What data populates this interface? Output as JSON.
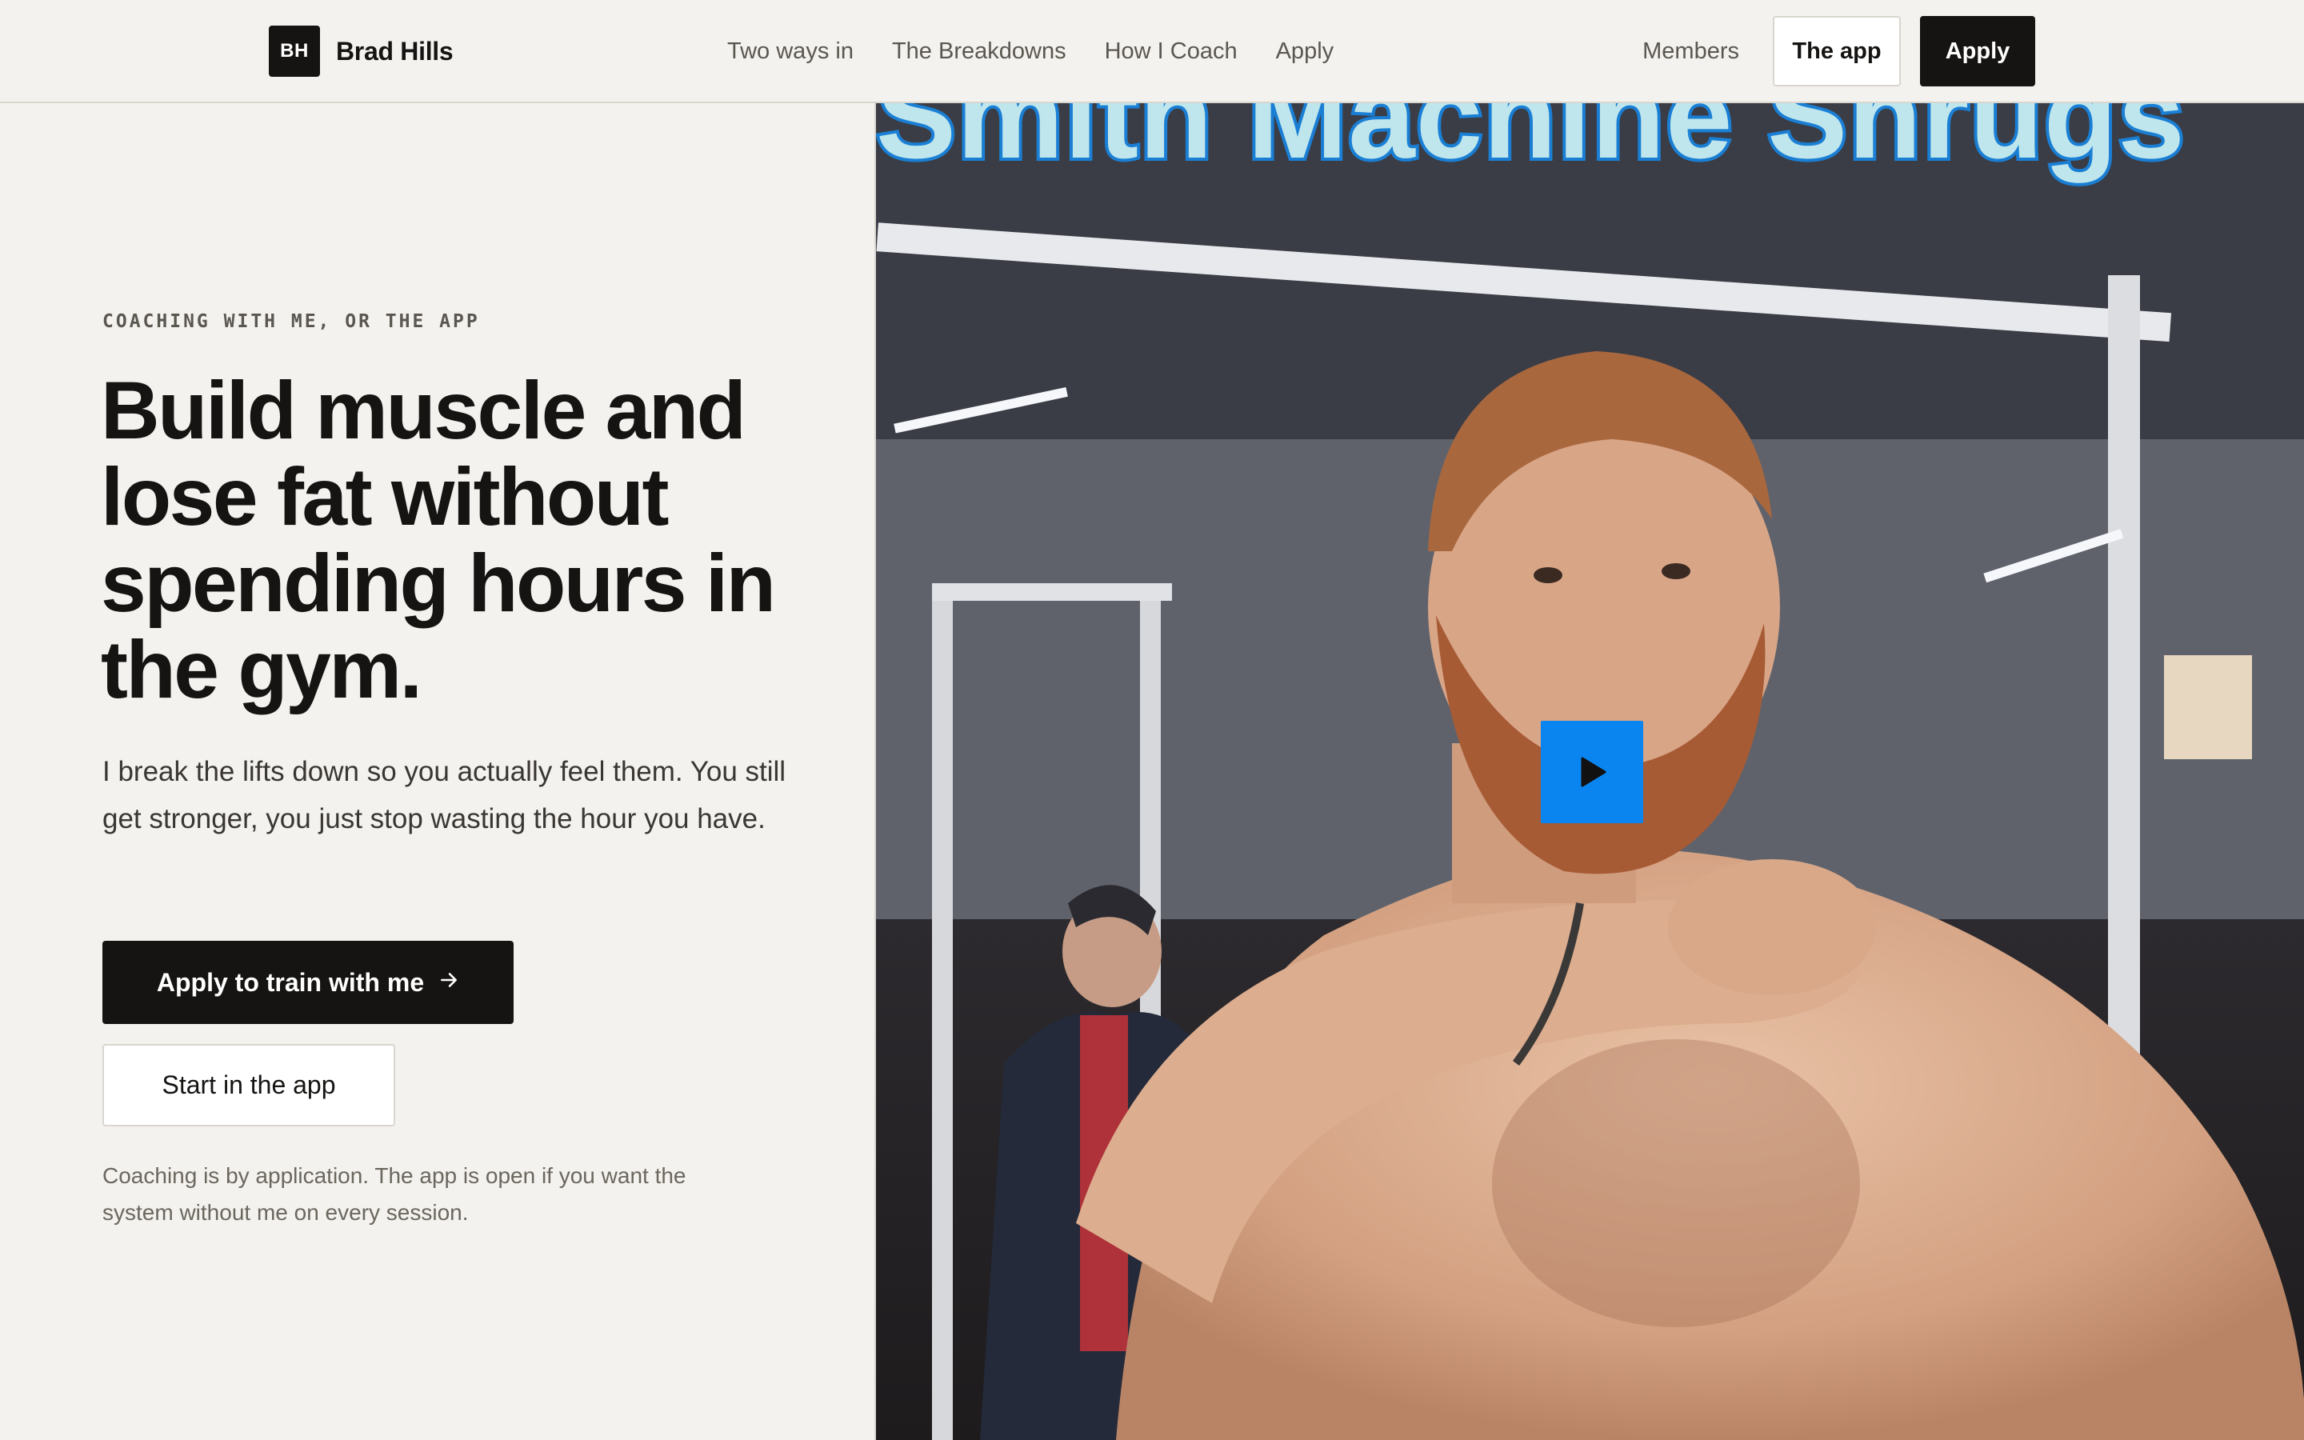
{
  "nav": {
    "brand_mark": "BH",
    "brand_name": "Brad Hills",
    "links": [
      "Two ways in",
      "The Breakdowns",
      "How I Coach",
      "Apply"
    ],
    "members": "Members",
    "app_button": "The app",
    "apply_button": "Apply"
  },
  "hero": {
    "eyebrow": "COACHING WITH ME, OR THE APP",
    "headline": "Build muscle and lose fat without spending hours in the gym.",
    "subcopy": "I break the lifts down so you actually feel them. You still get stronger, you just stop wasting the hour you have.",
    "primary_cta": "Apply to train with me",
    "primary_cta_icon": "arrow-right-icon",
    "secondary_cta": "Start in the app",
    "footnote": "Coaching is by application. The app is open if you want the system without me on every session."
  },
  "video": {
    "caption": "Smith Machine Shrugs",
    "play_icon": "play-icon"
  },
  "colors": {
    "background": "#f4f2ee",
    "ink": "#161412",
    "muted": "#5a5650",
    "border": "#d9d6d0",
    "play_accent": "#0a84ef",
    "caption_fill": "#bfe6ec",
    "caption_stroke": "#1a7fd4"
  }
}
